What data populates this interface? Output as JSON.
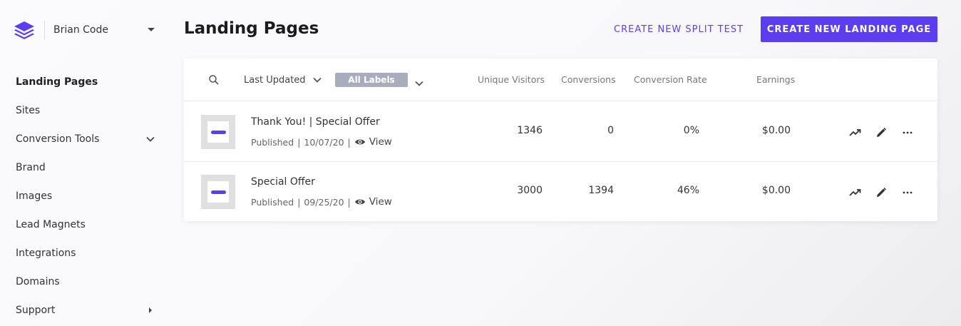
{
  "account": {
    "name": "Brian Code"
  },
  "sidebar": {
    "items": [
      {
        "label": "Landing Pages",
        "active": true
      },
      {
        "label": "Sites"
      },
      {
        "label": "Conversion Tools",
        "expandable": "down"
      },
      {
        "label": "Brand"
      },
      {
        "label": "Images"
      },
      {
        "label": "Lead Magnets"
      },
      {
        "label": "Integrations"
      },
      {
        "label": "Domains"
      },
      {
        "label": "Support",
        "expandable": "right"
      }
    ]
  },
  "header": {
    "title": "Landing Pages",
    "split_test_label": "CREATE NEW SPLIT TEST",
    "create_label": "CREATE NEW LANDING PAGE"
  },
  "toolbar": {
    "sort_label": "Last Updated",
    "label_filter": "All Labels",
    "columns": [
      "Unique Visitors",
      "Conversions",
      "Conversion Rate",
      "Earnings"
    ]
  },
  "rows": [
    {
      "title": "Thank You! | Special Offer",
      "status": "Published",
      "date": "10/07/20",
      "view_label": "View",
      "unique_visitors": "1346",
      "conversions": "0",
      "conversion_rate": "0%",
      "earnings": "$0.00"
    },
    {
      "title": "Special Offer",
      "status": "Published",
      "date": "09/25/20",
      "view_label": "View",
      "unique_visitors": "3000",
      "conversions": "1394",
      "conversion_rate": "46%",
      "earnings": "$0.00"
    }
  ],
  "colors": {
    "accent": "#5b3ef0",
    "label_chip": "#a8acbd"
  }
}
